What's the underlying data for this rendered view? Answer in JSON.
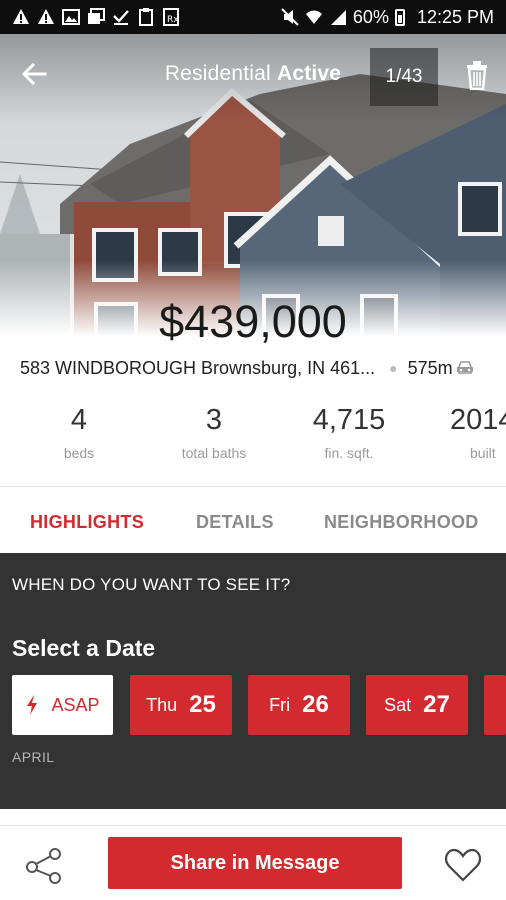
{
  "status_bar": {
    "battery": "60%",
    "time": "12:25 PM"
  },
  "header": {
    "title_prefix": "Residential ",
    "title_status": "Active",
    "photo_counter": "1/43"
  },
  "listing": {
    "price": "$439,000",
    "address": "583 WINDBOROUGH Brownsburg, IN 461...",
    "distance": "575m"
  },
  "stats": [
    {
      "value": "4",
      "label": "beds"
    },
    {
      "value": "3",
      "label": "total baths"
    },
    {
      "value": "4,715",
      "label": "fin. sqft."
    },
    {
      "value": "2014",
      "label": "built"
    }
  ],
  "tabs": [
    {
      "label": "HIGHLIGHTS",
      "active": true
    },
    {
      "label": "DETAILS",
      "active": false
    },
    {
      "label": "NEIGHBORHOOD",
      "active": false
    }
  ],
  "schedule": {
    "question": "WHEN DO YOU WANT TO SEE IT?",
    "select_label": "Select a Date",
    "asap_label": "ASAP",
    "dates": [
      {
        "day": "Thu",
        "num": "25"
      },
      {
        "day": "Fri",
        "num": "26"
      },
      {
        "day": "Sat",
        "num": "27"
      }
    ],
    "month": "APRIL"
  },
  "actions": {
    "share_label": "Share in Message"
  },
  "colors": {
    "accent": "#d32a2f",
    "dark_panel": "#333333"
  },
  "icons": [
    "back-arrow-icon",
    "trash-icon",
    "car-icon",
    "lightning-icon",
    "share-icon",
    "heart-icon"
  ]
}
